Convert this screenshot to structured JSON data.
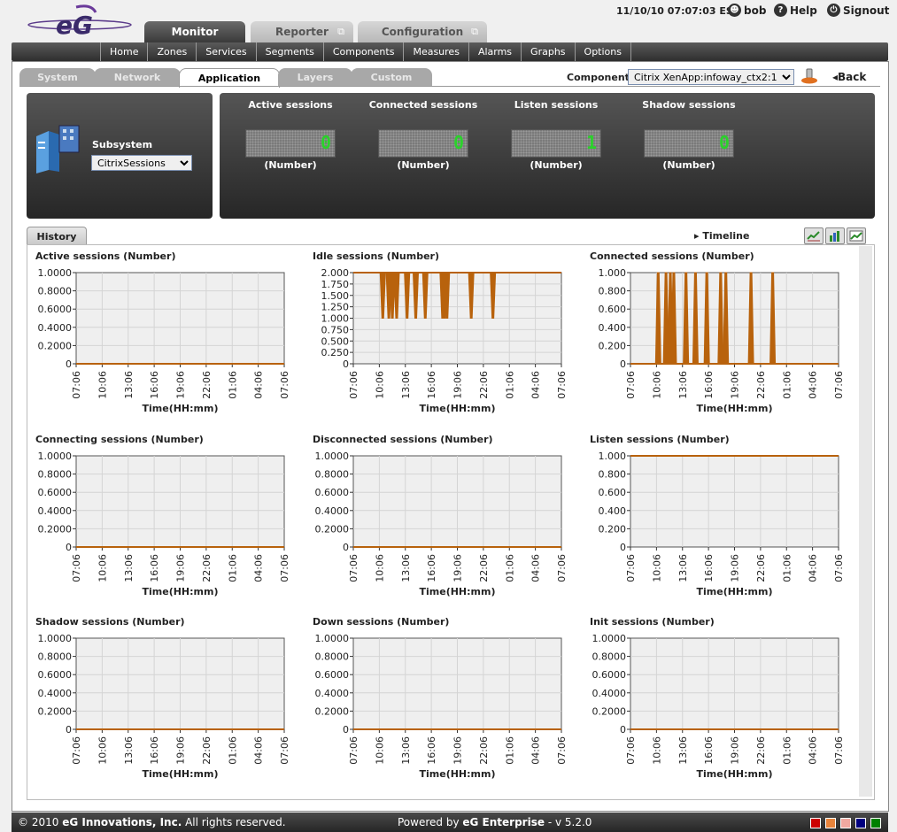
{
  "header": {
    "logo_text": "eG",
    "datetime": "11/10/10 07:07:03 EST",
    "user": "bob",
    "help": "Help",
    "signout": "Signout",
    "main_tabs": [
      {
        "label": "Monitor",
        "active": true
      },
      {
        "label": "Reporter",
        "active": false
      },
      {
        "label": "Configuration",
        "active": false
      }
    ]
  },
  "nav": [
    "Home",
    "Zones",
    "Services",
    "Segments",
    "Components",
    "Measures",
    "Alarms",
    "Graphs",
    "Options"
  ],
  "subtabs": [
    {
      "label": "System",
      "active": false
    },
    {
      "label": "Network",
      "active": false
    },
    {
      "label": "Application",
      "active": true
    },
    {
      "label": "Layers",
      "active": false
    },
    {
      "label": "Custom",
      "active": false
    }
  ],
  "component": {
    "label": "Component",
    "value": "Citrix XenApp:infoway_ctx2:1",
    "back": "Back"
  },
  "subsystem": {
    "label": "Subsystem",
    "value": "CitrixSessions"
  },
  "measures": [
    {
      "title": "Active sessions",
      "value": "0",
      "unit": "(Number)"
    },
    {
      "title": "Connected sessions",
      "value": "0",
      "unit": "(Number)"
    },
    {
      "title": "Listen sessions",
      "value": "1",
      "unit": "(Number)"
    },
    {
      "title": "Shadow sessions",
      "value": "0",
      "unit": "(Number)"
    }
  ],
  "history": {
    "tab": "History",
    "timeline": "Timeline"
  },
  "colors": {
    "series": "#b8620c",
    "plot_bg": "#efefef",
    "grid": "#d4d4d4",
    "footer_squares": [
      "#cc0000",
      "#e8843c",
      "#f0a8a0",
      "#000080",
      "#008000"
    ]
  },
  "chart_data": [
    {
      "type": "area",
      "title": "Active sessions (Number)",
      "xlabel": "Time(HH:mm)",
      "ylabel": "",
      "x_ticks": [
        "07:06",
        "10:06",
        "13:06",
        "16:06",
        "19:06",
        "22:06",
        "01:06",
        "04:06",
        "07:06"
      ],
      "y_ticks": [
        "0",
        "0.2000",
        "0.4000",
        "0.6000",
        "0.8000",
        "1.0000"
      ],
      "ylim": [
        0,
        1
      ],
      "grid": true,
      "flat_value": 0,
      "spikes": []
    },
    {
      "type": "area",
      "title": "Idle sessions (Number)",
      "xlabel": "Time(HH:mm)",
      "ylabel": "",
      "x_ticks": [
        "07:06",
        "10:06",
        "13:06",
        "16:06",
        "19:06",
        "22:06",
        "01:06",
        "04:06",
        "07:06"
      ],
      "y_ticks": [
        "0",
        "0.250",
        "0.500",
        "0.750",
        "1.000",
        "1.250",
        "1.500",
        "1.750",
        "2.000"
      ],
      "ylim": [
        0,
        2
      ],
      "grid": true,
      "flat_value": 2,
      "spikes": [
        {
          "hour": 3.4,
          "value": 1
        },
        {
          "hour": 4.1,
          "value": 1
        },
        {
          "hour": 4.5,
          "value": 1
        },
        {
          "hour": 5.0,
          "value": 1
        },
        {
          "hour": 6.2,
          "value": 1
        },
        {
          "hour": 7.2,
          "value": 1
        },
        {
          "hour": 8.3,
          "value": 1
        },
        {
          "hour": 10.3,
          "value": 1
        },
        {
          "hour": 10.5,
          "value": 1
        },
        {
          "hour": 10.8,
          "value": 1
        },
        {
          "hour": 13.6,
          "value": 1
        },
        {
          "hour": 16.1,
          "value": 1
        }
      ]
    },
    {
      "type": "area",
      "title": "Connected sessions (Number)",
      "xlabel": "Time(HH:mm)",
      "ylabel": "",
      "x_ticks": [
        "07:06",
        "10:06",
        "13:06",
        "16:06",
        "19:06",
        "22:06",
        "01:06",
        "04:06",
        "07:06"
      ],
      "y_ticks": [
        "0",
        "0.200",
        "0.400",
        "0.600",
        "0.800",
        "1.000"
      ],
      "ylim": [
        0,
        1
      ],
      "grid": true,
      "flat_value": 0,
      "spikes": [
        {
          "hour": 3.2,
          "value": 1
        },
        {
          "hour": 4.1,
          "value": 1
        },
        {
          "hour": 4.6,
          "value": 1
        },
        {
          "hour": 5.0,
          "value": 1
        },
        {
          "hour": 6.4,
          "value": 1
        },
        {
          "hour": 7.5,
          "value": 1
        },
        {
          "hour": 8.8,
          "value": 1
        },
        {
          "hour": 10.4,
          "value": 1
        },
        {
          "hour": 11.0,
          "value": 1
        },
        {
          "hour": 13.9,
          "value": 1
        },
        {
          "hour": 16.4,
          "value": 1
        }
      ]
    },
    {
      "type": "area",
      "title": "Connecting sessions (Number)",
      "xlabel": "Time(HH:mm)",
      "ylabel": "",
      "x_ticks": [
        "07:06",
        "10:06",
        "13:06",
        "16:06",
        "19:06",
        "22:06",
        "01:06",
        "04:06",
        "07:06"
      ],
      "y_ticks": [
        "0",
        "0.2000",
        "0.4000",
        "0.6000",
        "0.8000",
        "1.0000"
      ],
      "ylim": [
        0,
        1
      ],
      "grid": true,
      "flat_value": 0,
      "spikes": []
    },
    {
      "type": "area",
      "title": "Disconnected sessions (Number)",
      "xlabel": "Time(HH:mm)",
      "ylabel": "",
      "x_ticks": [
        "07:06",
        "10:06",
        "13:06",
        "16:06",
        "19:06",
        "22:06",
        "01:06",
        "04:06",
        "07:06"
      ],
      "y_ticks": [
        "0",
        "0.2000",
        "0.4000",
        "0.6000",
        "0.8000",
        "1.0000"
      ],
      "ylim": [
        0,
        1
      ],
      "grid": true,
      "flat_value": 0,
      "spikes": []
    },
    {
      "type": "area",
      "title": "Listen sessions (Number)",
      "xlabel": "Time(HH:mm)",
      "ylabel": "",
      "x_ticks": [
        "07:06",
        "10:06",
        "13:06",
        "16:06",
        "19:06",
        "22:06",
        "01:06",
        "04:06",
        "07:06"
      ],
      "y_ticks": [
        "0",
        "0.200",
        "0.400",
        "0.600",
        "0.800",
        "1.000"
      ],
      "ylim": [
        0,
        1
      ],
      "grid": true,
      "flat_value": 1,
      "spikes": []
    },
    {
      "type": "area",
      "title": "Shadow sessions (Number)",
      "xlabel": "Time(HH:mm)",
      "ylabel": "",
      "x_ticks": [
        "07:06",
        "10:06",
        "13:06",
        "16:06",
        "19:06",
        "22:06",
        "01:06",
        "04:06",
        "07:06"
      ],
      "y_ticks": [
        "0",
        "0.2000",
        "0.4000",
        "0.6000",
        "0.8000",
        "1.0000"
      ],
      "ylim": [
        0,
        1
      ],
      "grid": true,
      "flat_value": 0,
      "spikes": []
    },
    {
      "type": "area",
      "title": "Down sessions (Number)",
      "xlabel": "Time(HH:mm)",
      "ylabel": "",
      "x_ticks": [
        "07:06",
        "10:06",
        "13:06",
        "16:06",
        "19:06",
        "22:06",
        "01:06",
        "04:06",
        "07:06"
      ],
      "y_ticks": [
        "0",
        "0.2000",
        "0.4000",
        "0.6000",
        "0.8000",
        "1.0000"
      ],
      "ylim": [
        0,
        1
      ],
      "grid": true,
      "flat_value": 0,
      "spikes": []
    },
    {
      "type": "area",
      "title": "Init sessions (Number)",
      "xlabel": "Time(HH:mm)",
      "ylabel": "",
      "x_ticks": [
        "07:06",
        "10:06",
        "13:06",
        "16:06",
        "19:06",
        "22:06",
        "01:06",
        "04:06",
        "07:06"
      ],
      "y_ticks": [
        "0",
        "0.2000",
        "0.4000",
        "0.6000",
        "0.8000",
        "1.0000"
      ],
      "ylim": [
        0,
        1
      ],
      "grid": true,
      "flat_value": 0,
      "spikes": []
    }
  ],
  "footer": {
    "copyright_prefix": "© 2010",
    "company": "eG Innovations, Inc.",
    "rights": "All rights reserved.",
    "powered_prefix": "Powered by",
    "product": "eG Enterprise",
    "version": "- v 5.2.0"
  }
}
